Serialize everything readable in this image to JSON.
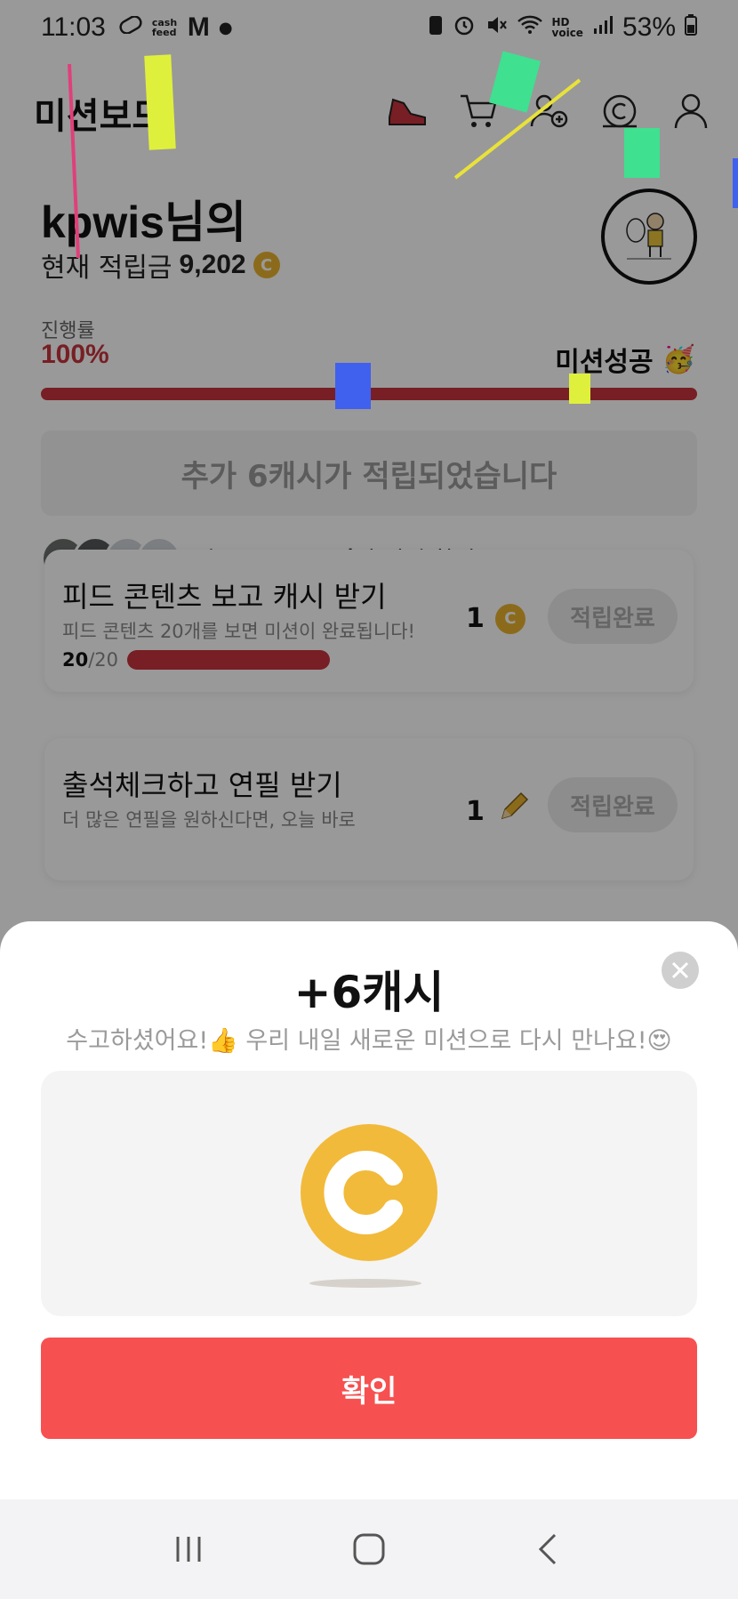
{
  "status_bar": {
    "time": "11:03",
    "left_icons": [
      "pill-icon",
      "cashfeed-icon",
      "m-icon",
      "dot-icon"
    ],
    "cashfeed_label": "cash feed",
    "battery": "53%"
  },
  "header": {
    "title": "미션보드",
    "icons": [
      "sneaker-icon",
      "cart-icon",
      "add-friend-icon",
      "cash-icon",
      "profile-icon"
    ]
  },
  "user": {
    "greeting": "kpwis님의",
    "points_label": "현재 적립금",
    "points_value": "9,202"
  },
  "progress": {
    "label": "진행률",
    "value": "100%",
    "fraction": 1.0,
    "success_label": "미션성공",
    "success_emoji": "🥳"
  },
  "notice": "추가 6캐시가 적립되었습니다",
  "participants": {
    "prefix": "지금, ",
    "count": "18,888명",
    "suffix": "이 미션 참여중!"
  },
  "missions": [
    {
      "title": "피드 콘텐츠 보고 캐시 받기",
      "desc": "피드 콘텐츠 20개를 보면 미션이 완료됩니다!",
      "progress_current": "20",
      "progress_total": "/20",
      "reward": "1",
      "button": "적립완료"
    },
    {
      "title": "출석체크하고 연필 받기",
      "desc": "더 많은 연필을 원하신다면, 오늘 바로",
      "reward": "1",
      "button": "적립완료"
    }
  ],
  "sheet": {
    "title": "+6캐시",
    "message": "수고하셨어요!👍 우리 내일 새로운 미션으로 다시 만나요!😍",
    "confirm": "확인"
  },
  "colors": {
    "accent_red": "#c6343c",
    "confirm_red": "#f75050",
    "coin_gold": "#f2ba3a"
  }
}
